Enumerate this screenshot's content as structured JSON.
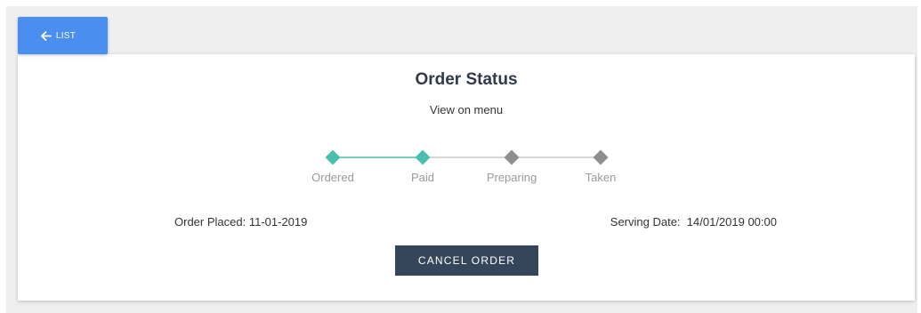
{
  "nav": {
    "back_label": "LIST",
    "back_icon": "arrow-left-icon"
  },
  "order": {
    "title": "Order Status",
    "view_link": "View on menu",
    "steps": [
      {
        "label": "Ordered",
        "status": "complete"
      },
      {
        "label": "Paid",
        "status": "complete"
      },
      {
        "label": "Preparing",
        "status": "pending"
      },
      {
        "label": "Taken",
        "status": "pending"
      }
    ],
    "placed_label": "Order Placed:",
    "placed_value": "11-01-2019",
    "serving_label": "Serving Date:",
    "serving_value": "14/01/2019 00:00",
    "cancel_label": "CANCEL ORDER"
  },
  "colors": {
    "primary": "#4a8ff0",
    "complete": "#4bbfad",
    "pending": "#8e8e8e",
    "dark_button": "#36465a"
  }
}
